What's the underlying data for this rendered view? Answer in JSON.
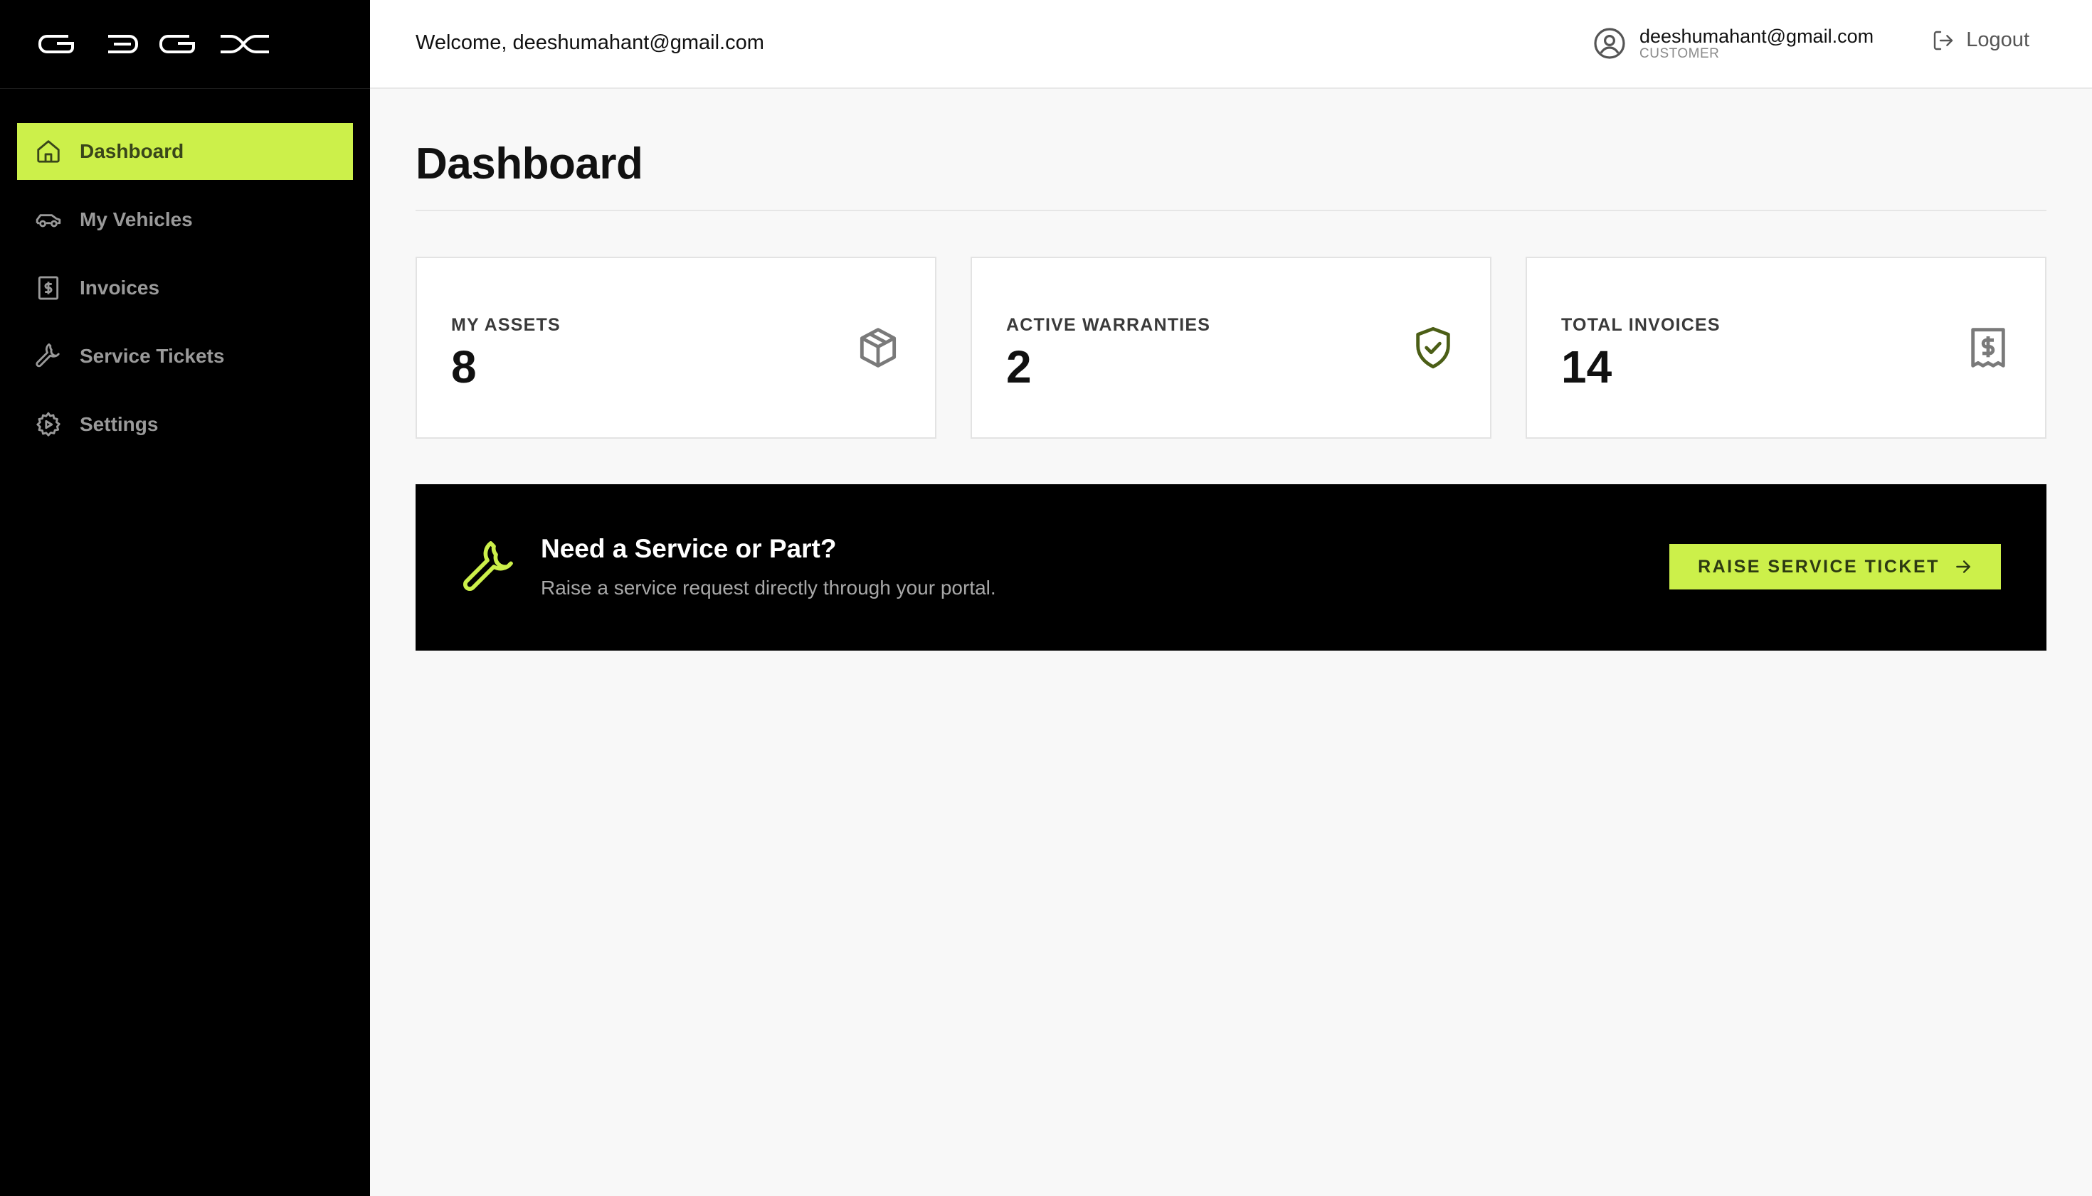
{
  "brand": {
    "logo_text": "GBGX",
    "accent_color": "#ccf04a"
  },
  "sidebar": {
    "items": [
      {
        "label": "Dashboard",
        "icon": "home-icon",
        "active": true
      },
      {
        "label": "My Vehicles",
        "icon": "car-icon",
        "active": false
      },
      {
        "label": "Invoices",
        "icon": "dollar-document-icon",
        "active": false
      },
      {
        "label": "Service Tickets",
        "icon": "wrench-icon",
        "active": false
      },
      {
        "label": "Settings",
        "icon": "gear-icon",
        "active": false
      }
    ]
  },
  "header": {
    "welcome": "Welcome, deeshumahant@gmail.com",
    "user_email": "deeshumahant@gmail.com",
    "user_role": "CUSTOMER",
    "logout_label": "Logout"
  },
  "main": {
    "title": "Dashboard",
    "cards": [
      {
        "label": "MY ASSETS",
        "value": "8",
        "icon": "box-icon"
      },
      {
        "label": "ACTIVE WARRANTIES",
        "value": "2",
        "icon": "shield-check-icon"
      },
      {
        "label": "TOTAL INVOICES",
        "value": "14",
        "icon": "receipt-icon"
      }
    ],
    "cta": {
      "title": "Need a Service or Part?",
      "subtitle": "Raise a service request directly through your portal.",
      "button_label": "RAISE SERVICE TICKET",
      "icon": "wrench-icon"
    }
  }
}
